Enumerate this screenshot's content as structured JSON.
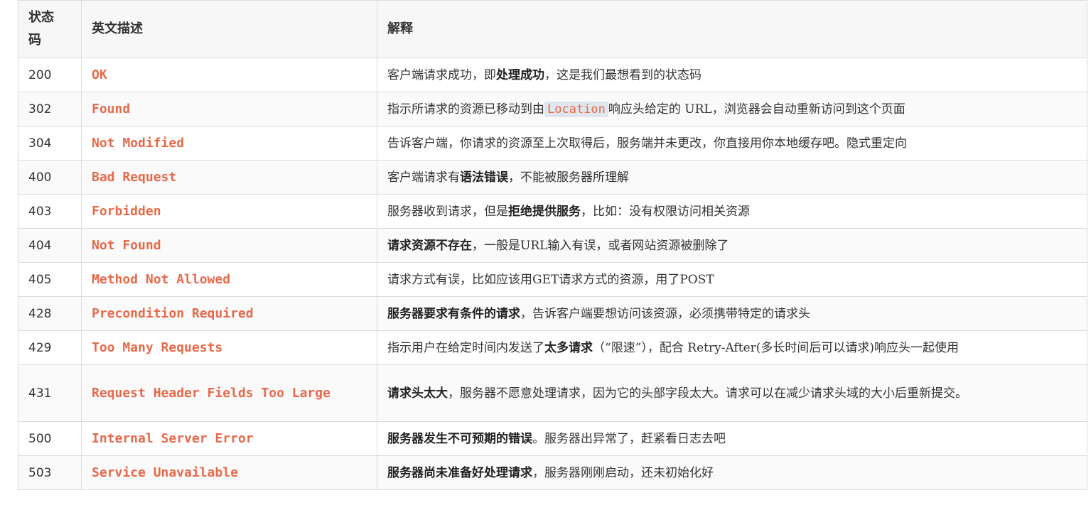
{
  "header": {
    "code": "状态码",
    "english": "英文描述",
    "explain": "解释"
  },
  "rows": [
    {
      "code": "200",
      "en": "OK",
      "parts": [
        {
          "t": "客户端请求成功，即"
        },
        {
          "t": "处理成功",
          "b": true
        },
        {
          "t": "，这是我们最想看到的状态码"
        }
      ]
    },
    {
      "code": "302",
      "en": "Found",
      "parts": [
        {
          "t": "指示所请求的资源已移动到由"
        },
        {
          "t": "Location",
          "code": true
        },
        {
          "t": "响应头给定的 URL，浏览器会自动重新访问到这个页面"
        }
      ]
    },
    {
      "code": "304",
      "en": "Not Modified",
      "parts": [
        {
          "t": "告诉客户端，你请求的资源至上次取得后，服务端并未更改，你直接用你本地缓存吧。隐式重定向"
        }
      ]
    },
    {
      "code": "400",
      "en": "Bad Request",
      "parts": [
        {
          "t": "客户端请求有"
        },
        {
          "t": "语法错误",
          "b": true
        },
        {
          "t": "，不能被服务器所理解"
        }
      ]
    },
    {
      "code": "403",
      "en": "Forbidden",
      "parts": [
        {
          "t": "服务器收到请求，但是"
        },
        {
          "t": "拒绝提供服务",
          "b": true
        },
        {
          "t": "，比如：没有权限访问相关资源"
        }
      ]
    },
    {
      "code": "404",
      "en": "Not Found",
      "parts": [
        {
          "t": "请求资源不存在",
          "b": true
        },
        {
          "t": "，一般是URL输入有误，或者网站资源被删除了"
        }
      ]
    },
    {
      "code": "405",
      "en": "Method Not Allowed",
      "parts": [
        {
          "t": "请求方式有误，比如应该用GET请求方式的资源，用了POST"
        }
      ]
    },
    {
      "code": "428",
      "en": "Precondition Required",
      "parts": [
        {
          "t": "服务器要求有条件的请求",
          "b": true
        },
        {
          "t": "，告诉客户端要想访问该资源，必须携带特定的请求头"
        }
      ]
    },
    {
      "code": "429",
      "en": "Too Many Requests",
      "parts": [
        {
          "t": "指示用户在给定时间内发送了"
        },
        {
          "t": "太多请求",
          "b": true
        },
        {
          "t": "（“限速”），配合 Retry-After(多长时间后可以请求)响应头一起使用"
        }
      ]
    },
    {
      "code": "431",
      "en": "Request Header Fields Too Large",
      "tall": true,
      "parts": [
        {
          "t": "请求头太大",
          "b": true
        },
        {
          "t": "，服务器不愿意处理请求，因为它的头部字段太大。请求可以在减少请求头域的大小后重新提交。"
        }
      ]
    },
    {
      "code": "500",
      "en": "Internal Server Error",
      "parts": [
        {
          "t": "服务器发生不可预期的错误",
          "b": true
        },
        {
          "t": "。服务器出异常了，赶紧看日志去吧"
        }
      ]
    },
    {
      "code": "503",
      "en": "Service Unavailable",
      "parts": [
        {
          "t": "服务器尚未准备好处理请求",
          "b": true
        },
        {
          "t": "，服务器刚刚启动，还未初始化好"
        }
      ]
    }
  ]
}
